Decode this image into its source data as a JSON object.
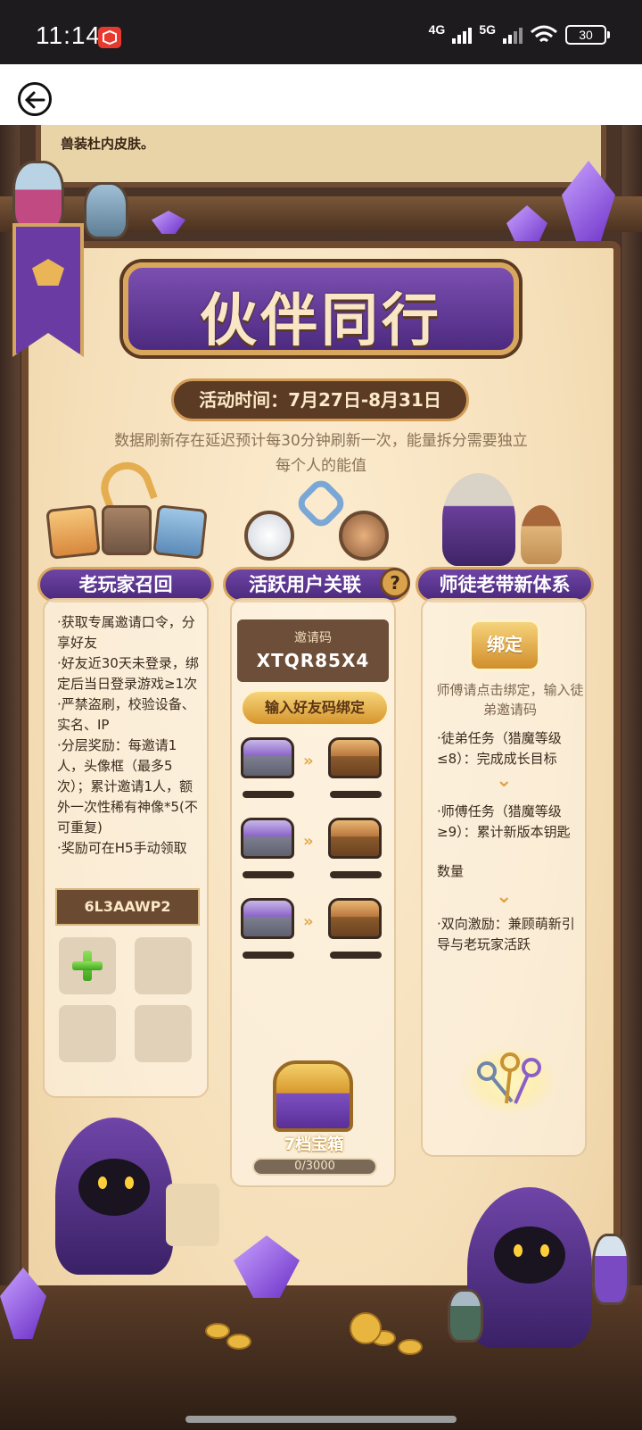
{
  "status_bar": {
    "time": "11:14",
    "app_icon_label": "",
    "network_1": "4G",
    "network_2": "5G",
    "battery": "30"
  },
  "nav": {
    "back_icon": "back-arrow-icon"
  },
  "top_scroll": {
    "text": "兽装杜内皮肤。"
  },
  "event": {
    "title": "伙伴同行",
    "date": "活动时间：7月27日-8月31日",
    "note": "数据刷新存在延迟预计每30分钟刷新一次，能量拆分需要独立每个人的能值"
  },
  "columns": {
    "left": {
      "header": "老玩家召回",
      "lines": [
        "·获取专属邀请口令，分享好友",
        "·好友近30天未登录，绑定后当日登录游戏≥1次",
        "·严禁盗刷，校验设备、实名、IP",
        "·分层奖励：每邀请1人，头像框（最多5次）；累计邀请1人，额外一次性稀有神像*5(不可重复)",
        "·奖励可在H5手动领取"
      ],
      "code": "6L3AAWP2"
    },
    "middle": {
      "header": "活跃用户关联",
      "help": "?",
      "invite_label": "邀请码",
      "invite_code": "XTQR85X4",
      "bind_friend_button": "输入好友码绑定",
      "tier_label": "7档宝箱",
      "progress": "0/3000",
      "progress_value": 0,
      "progress_max": 3000
    },
    "right": {
      "header": "师徒老带新体系",
      "bind_button": "绑定",
      "hint": "师傅请点击绑定，输入徒弟邀请码",
      "task_1": "·徒弟任务（猎魔等级≤8）：完成成长目标",
      "task_2_a": "·师傅任务（猎魔等级≥9）：累计新版本钥匙",
      "task_2_b": "数量",
      "task_3": "·双向激励：兼顾萌新引导与老玩家活跃"
    }
  },
  "colors": {
    "purple": "#5b3390",
    "gold": "#d9a65f",
    "parchment": "#f5dfb9",
    "wood": "#6f4a2f"
  }
}
